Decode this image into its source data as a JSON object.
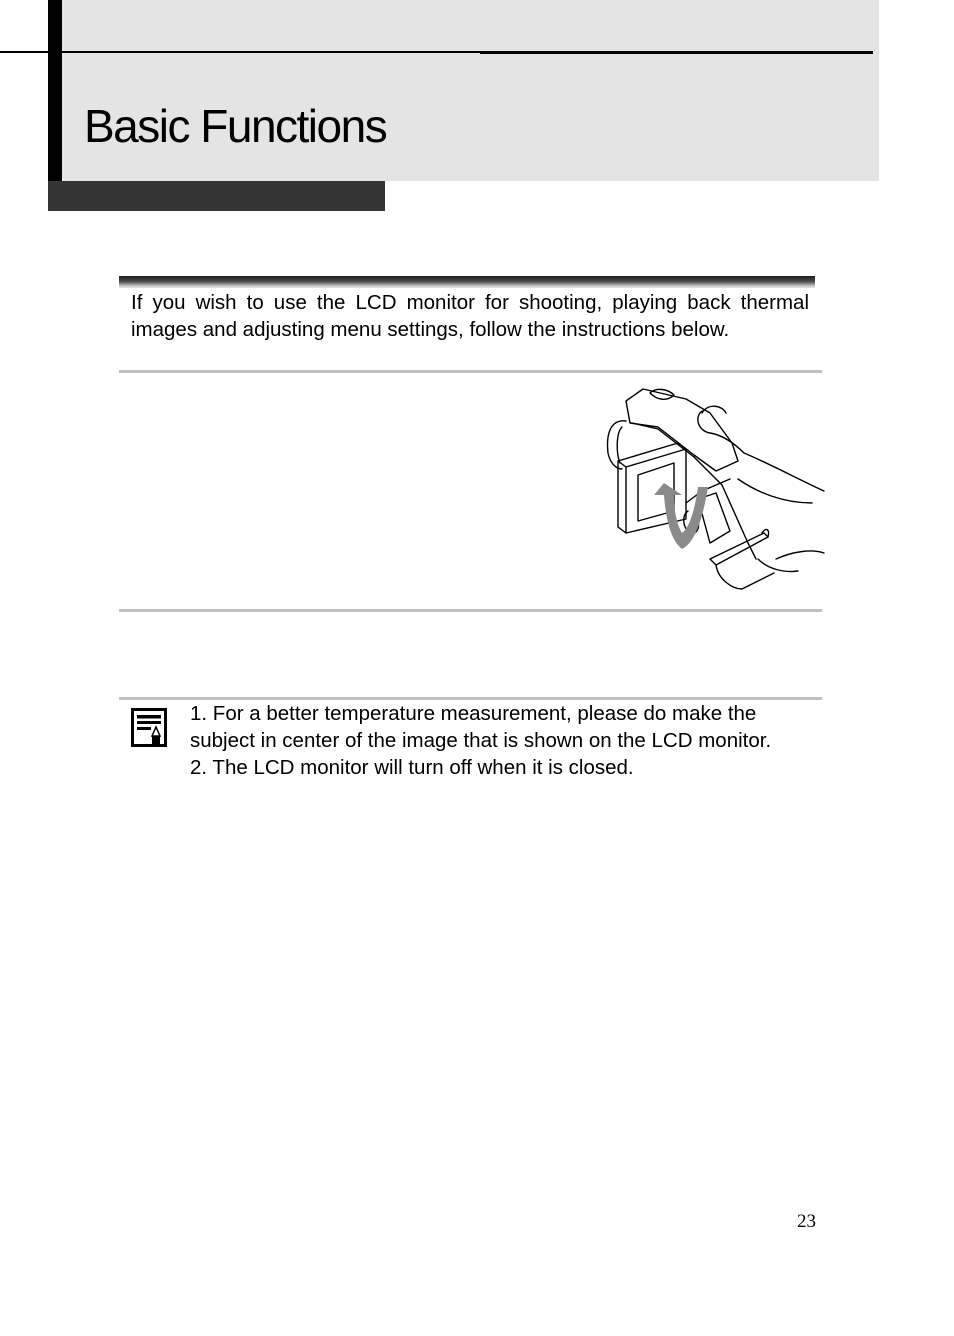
{
  "header": {
    "title": "Basic Functions"
  },
  "intro": {
    "text": "If you wish to use the LCD monitor for shooting, playing back thermal images and adjusting menu settings, follow the instructions below."
  },
  "illustration": {
    "description": "Hand holding thermal camera while flipping open the LCD monitor",
    "icon": "lcd-flip-illustration",
    "arrow_color": "#8a8a8a"
  },
  "note": {
    "icon": "note-pencil-icon",
    "items": [
      "1. For a better temperature measurement, please do make the subject in center of the image that is shown on the LCD monitor.",
      "2. The LCD monitor will turn off when it is closed."
    ]
  },
  "footer": {
    "page_number": "23"
  },
  "colors": {
    "header_band": "#e4e4e4",
    "header_dark_band": "#353535",
    "rule_gray": "#c0c0c0"
  }
}
